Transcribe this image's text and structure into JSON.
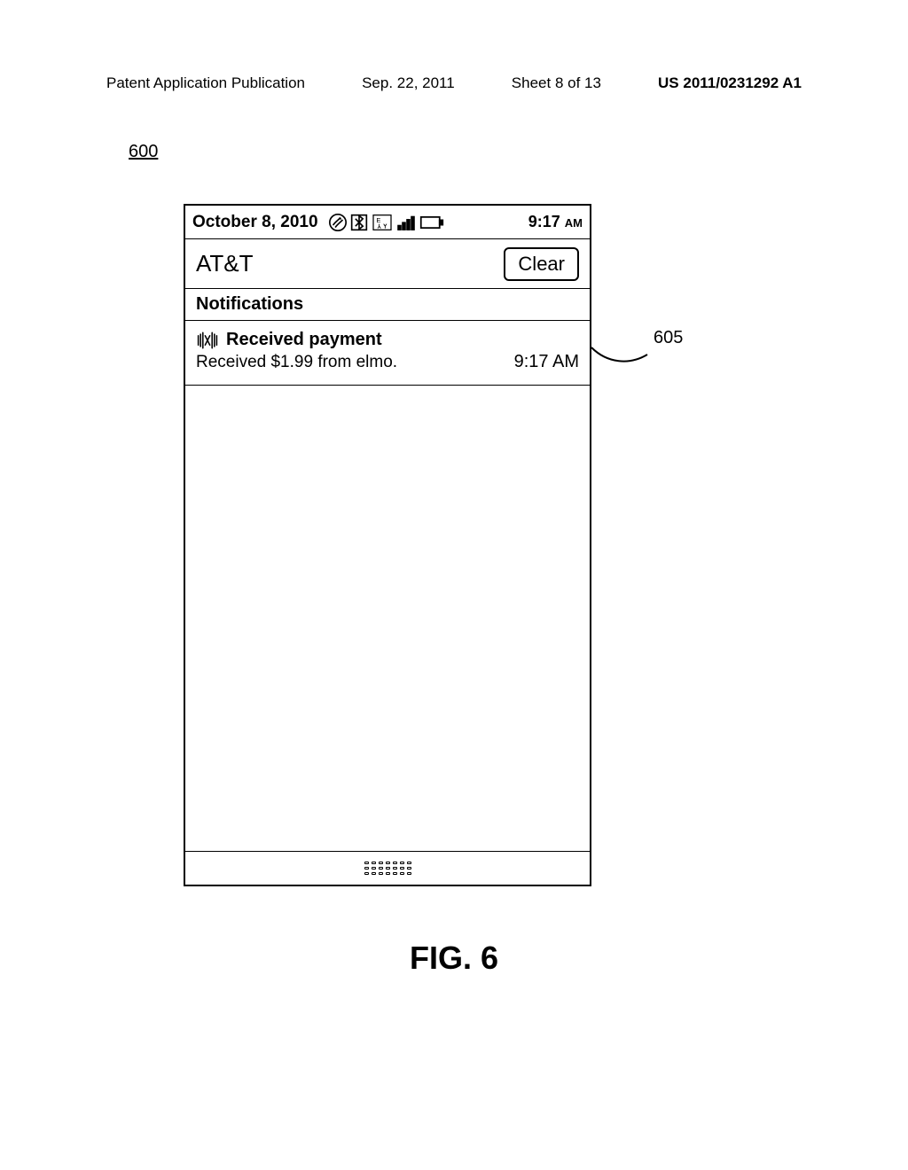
{
  "page_header": {
    "publication_type": "Patent Application Publication",
    "date": "Sep. 22, 2011",
    "sheet_info": "Sheet 8 of 13",
    "publication_number": "US 2011/0231292 A1"
  },
  "figure_ref": "600",
  "status_bar": {
    "date": "October 8, 2010",
    "time": "9:17",
    "ampm": "AM"
  },
  "carrier_bar": {
    "carrier": "AT&T",
    "clear_label": "Clear"
  },
  "notifications_header": "Notifications",
  "notification": {
    "title": "Received payment",
    "body": "Received $1.99 from elmo.",
    "time": "9:17 AM"
  },
  "callout_605": "605",
  "figure_caption": "FIG. 6"
}
